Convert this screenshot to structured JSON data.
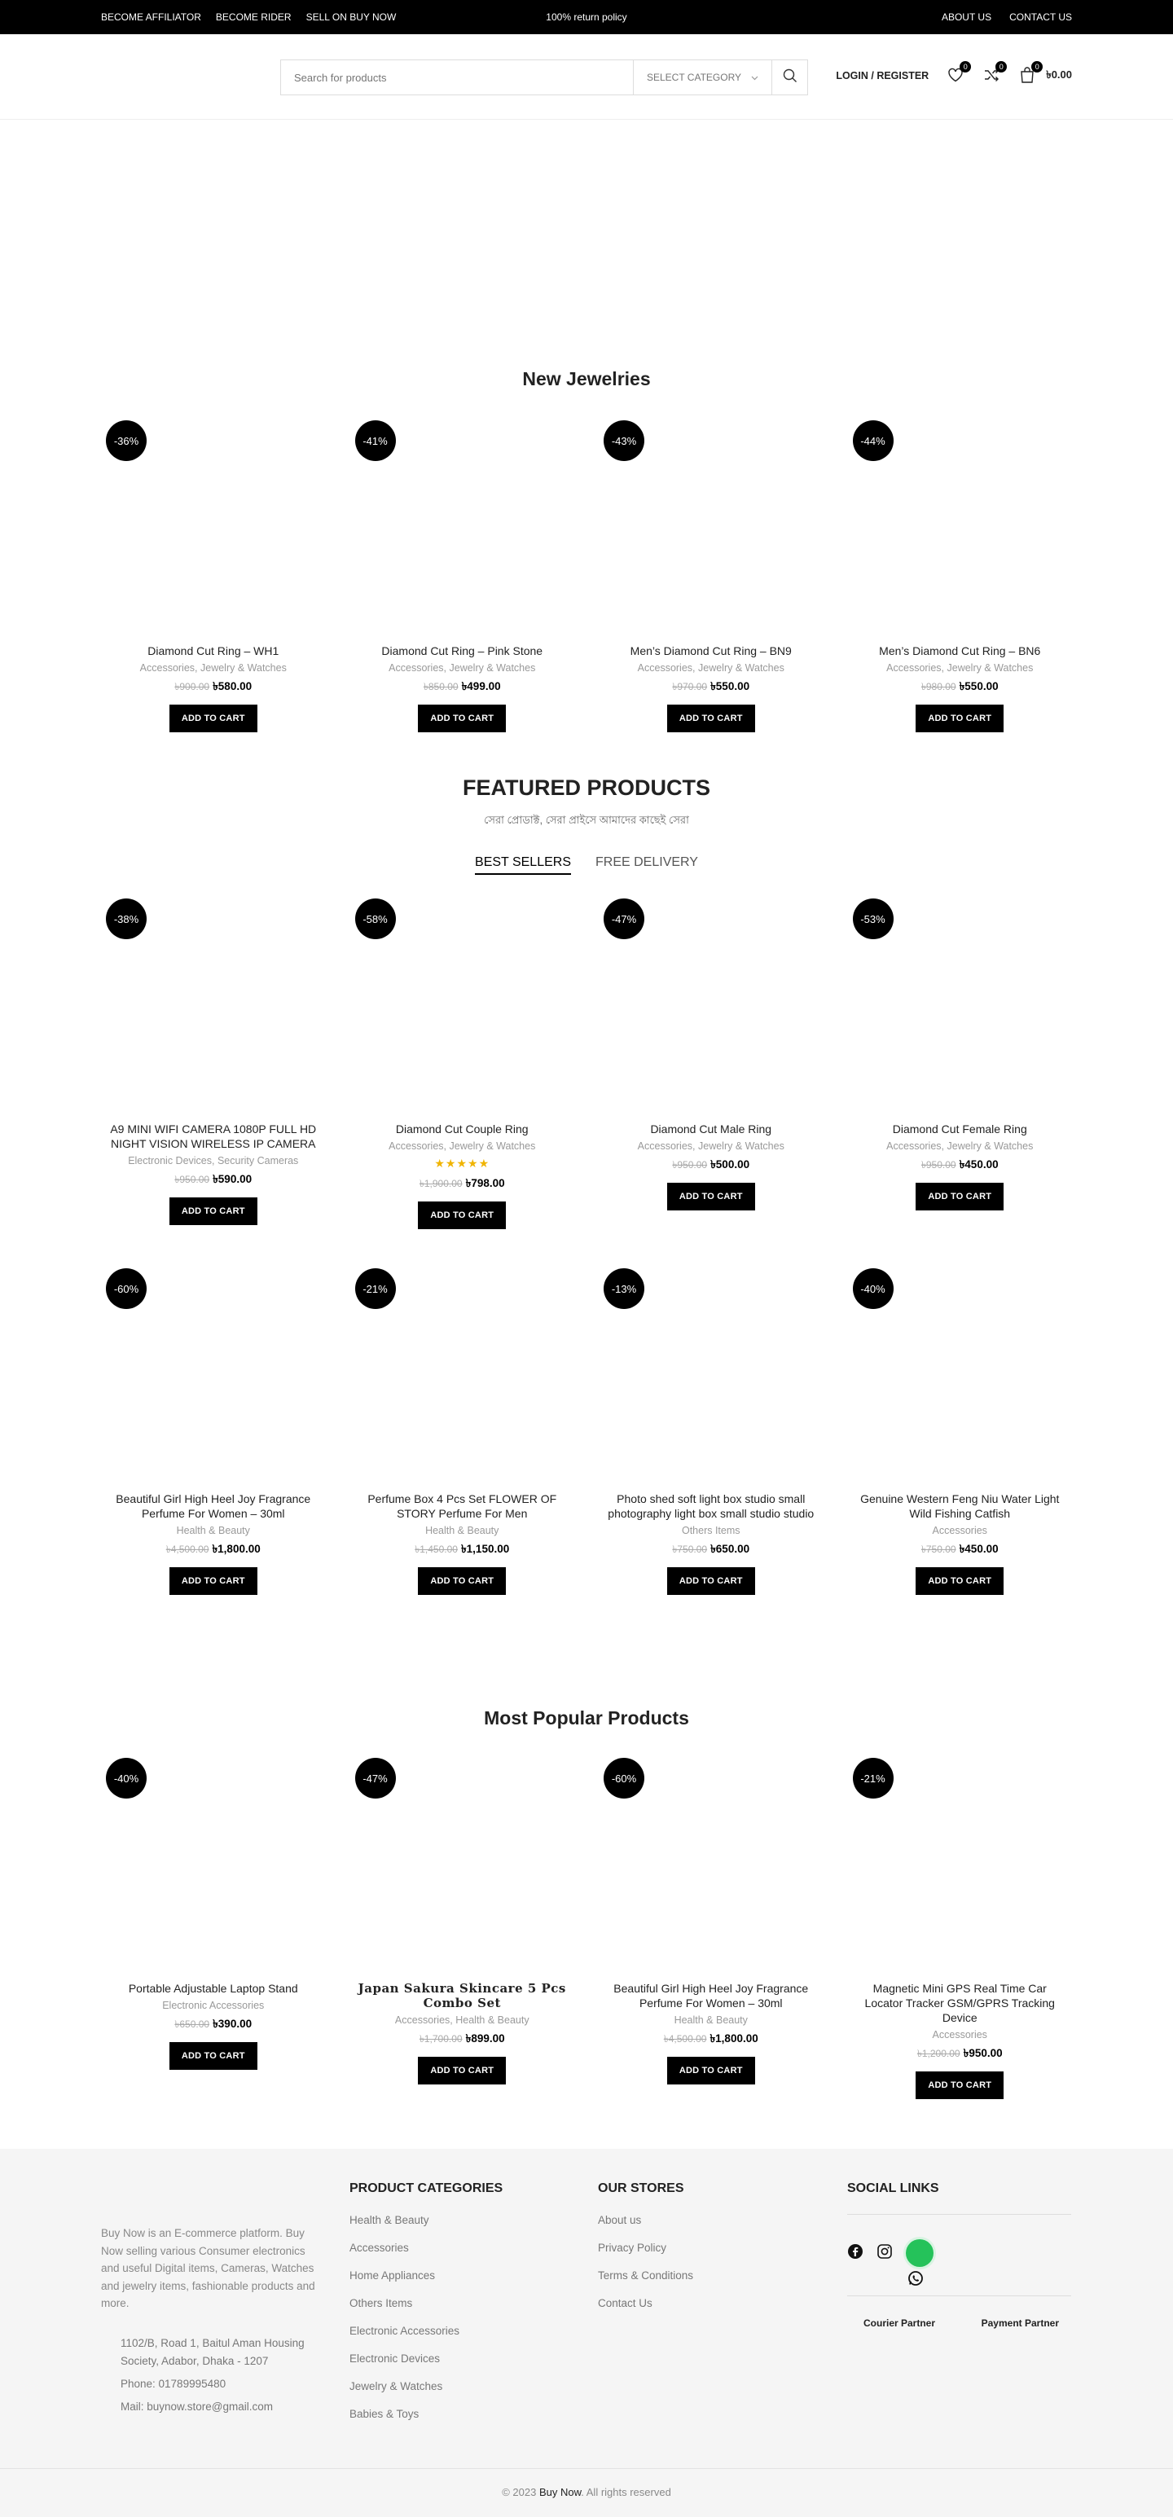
{
  "topbar": {
    "left_links": [
      "BECOME AFFILIATOR",
      "BECOME RIDER",
      "SELL ON BUY NOW"
    ],
    "center_text": "100% return policy",
    "right_links": [
      "ABOUT US",
      "CONTACT US"
    ]
  },
  "header": {
    "search_placeholder": "Search for products",
    "category_label": "SELECT CATEGORY",
    "login_label": "LOGIN / REGISTER",
    "wishlist_count": "0",
    "compare_count": "0",
    "cart_count": "0",
    "cart_total": "৳0.00"
  },
  "new_jewelries": {
    "title": "New Jewelries",
    "products": [
      {
        "discount": "-36%",
        "title": "Diamond Cut Ring – WH1",
        "cats": [
          "Accessories",
          "Jewelry & Watches"
        ],
        "old": "৳900.00",
        "new": "৳580.00",
        "btn": "ADD TO CART"
      },
      {
        "discount": "-41%",
        "title": "Diamond Cut Ring – Pink Stone",
        "cats": [
          "Accessories",
          "Jewelry & Watches"
        ],
        "old": "৳850.00",
        "new": "৳499.00",
        "btn": "ADD TO CART"
      },
      {
        "discount": "-43%",
        "title": "Men’s Diamond Cut Ring – BN9",
        "cats": [
          "Accessories",
          "Jewelry & Watches"
        ],
        "old": "৳970.00",
        "new": "৳550.00",
        "btn": "ADD TO CART"
      },
      {
        "discount": "-44%",
        "title": "Men’s Diamond Cut Ring – BN6",
        "cats": [
          "Accessories",
          "Jewelry & Watches"
        ],
        "old": "৳980.00",
        "new": "৳550.00",
        "btn": "ADD TO CART"
      }
    ]
  },
  "featured": {
    "title": "FEATURED PRODUCTS",
    "subtitle": "সেরা প্রোডাক্ট, সেরা প্রাইসে আমাদের কাছেই সেরা",
    "tabs": [
      "BEST SELLERS",
      "FREE DELIVERY"
    ],
    "products": [
      {
        "discount": "-38%",
        "title": "A9 MINI WIFI CAMERA 1080P FULL HD NIGHT VISION WIRELESS IP CAMERA",
        "cats": [
          "Electronic Devices",
          "Security Cameras"
        ],
        "old": "৳950.00",
        "new": "৳590.00",
        "btn": "ADD TO CART"
      },
      {
        "discount": "-58%",
        "title": "Diamond Cut Couple Ring",
        "cats": [
          "Accessories",
          "Jewelry & Watches"
        ],
        "rating": 5,
        "old": "৳1,900.00",
        "new": "৳798.00",
        "btn": "ADD TO CART"
      },
      {
        "discount": "-47%",
        "title": "Diamond Cut Male Ring",
        "cats": [
          "Accessories",
          "Jewelry & Watches"
        ],
        "old": "৳950.00",
        "new": "৳500.00",
        "btn": "ADD TO CART"
      },
      {
        "discount": "-53%",
        "title": "Diamond Cut Female Ring",
        "cats": [
          "Accessories",
          "Jewelry & Watches"
        ],
        "old": "৳950.00",
        "new": "৳450.00",
        "btn": "ADD TO CART"
      },
      {
        "discount": "-60%",
        "title": "Beautiful Girl High Heel Joy Fragrance Perfume For Women – 30ml",
        "cats": [
          "Health & Beauty"
        ],
        "old": "৳4,500.00",
        "new": "৳1,800.00",
        "btn": "ADD TO CART"
      },
      {
        "discount": "-21%",
        "title": "Perfume Box 4 Pcs Set FLOWER OF STORY Perfume For Men",
        "cats": [
          "Health & Beauty"
        ],
        "old": "৳1,450.00",
        "new": "৳1,150.00",
        "btn": "ADD TO CART"
      },
      {
        "discount": "-13%",
        "title": "Photo shed soft light box studio small photography light box small studio studio",
        "cats": [
          "Others Items"
        ],
        "old": "৳750.00",
        "new": "৳650.00",
        "btn": "ADD TO CART"
      },
      {
        "discount": "-40%",
        "title": "Genuine Western Feng Niu Water Light Wild Fishing Catfish",
        "cats": [
          "Accessories"
        ],
        "old": "৳750.00",
        "new": "৳450.00",
        "btn": "ADD TO CART"
      }
    ]
  },
  "popular": {
    "title": "Most Popular Products",
    "products": [
      {
        "discount": "-40%",
        "title": "Portable Adjustable Laptop Stand",
        "cats": [
          "Electronic Accessories"
        ],
        "old": "৳650.00",
        "new": "৳390.00",
        "btn": "ADD TO CART"
      },
      {
        "discount": "-47%",
        "title": "Japan Sakura Skincare 5 Pcs Combo Set",
        "cats": [
          "Accessories",
          "Health & Beauty"
        ],
        "old": "৳1,700.00",
        "new": "৳899.00",
        "btn": "ADD TO CART"
      },
      {
        "discount": "-60%",
        "title": "Beautiful Girl High Heel Joy Fragrance Perfume For Women – 30ml",
        "cats": [
          "Health & Beauty"
        ],
        "old": "৳4,500.00",
        "new": "৳1,800.00",
        "btn": "ADD TO CART"
      },
      {
        "discount": "-21%",
        "title": "Magnetic Mini GPS Real Time Car Locator Tracker GSM/GPRS Tracking Device",
        "cats": [
          "Accessories"
        ],
        "old": "৳1,200.00",
        "new": "৳950.00",
        "btn": "ADD TO CART"
      }
    ]
  },
  "footer": {
    "about": "Buy Now is an E-commerce platform. Buy Now selling various Consumer electronics and useful Digital items, Cameras, Watches and jewelry items, fashionable products and more.",
    "address": "1102/B, Road 1, Baitul Aman Housing Society, Adabor, Dhaka - 1207",
    "phone": "Phone: 01789995480",
    "mail": "Mail: buynow.store@gmail.com",
    "categories_title": "PRODUCT CATEGORIES",
    "categories": [
      "Health & Beauty",
      "Accessories",
      "Home Appliances",
      "Others Items",
      "Electronic Accessories",
      "Electronic Devices",
      "Jewelry & Watches",
      "Babies & Toys"
    ],
    "stores_title": "OUR STORES",
    "stores": [
      "About us",
      "Privacy Policy",
      "Terms & Conditions",
      "Contact Us"
    ],
    "social_title": "SOCIAL LINKS",
    "courier_label": "Courier Partner",
    "payment_label": "Payment Partner",
    "copyright_pre": "© 2023",
    "copyright_brand": "Buy Now",
    "copyright_post": ". All rights reserved"
  }
}
